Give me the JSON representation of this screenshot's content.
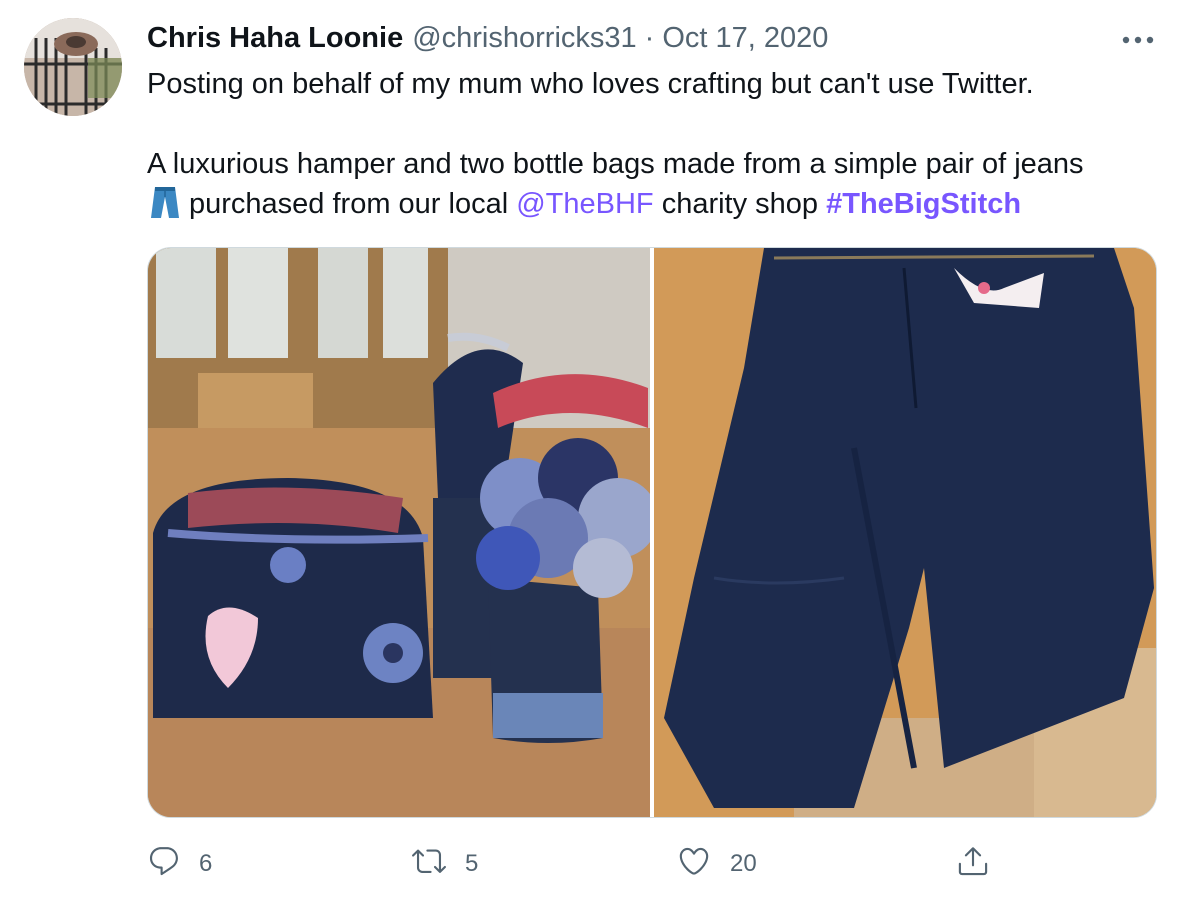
{
  "tweet": {
    "author_name": "Chris Haha Loonie",
    "author_handle": "@chrishorricks31",
    "separator": "·",
    "date": "Oct 17, 2020",
    "text_line1": "Posting on behalf of my mum who loves crafting but can't use Twitter.",
    "text_line2": "A luxurious hamper and two bottle bags made from a simple pair of jeans",
    "text_line3_part1": "purchased from our local",
    "mention": "@TheBHF",
    "text_line3_part2": "charity shop",
    "hashtag": "#TheBigStitch",
    "emoji_icon": "jeans-emoji"
  },
  "media": {
    "photos": [
      {
        "name": "photo-denim-hamper-and-bottle-bags"
      },
      {
        "name": "photo-pair-of-jeans"
      }
    ]
  },
  "actions": {
    "reply_count": "6",
    "retweet_count": "5",
    "like_count": "20",
    "icons": [
      "reply-icon",
      "retweet-icon",
      "like-icon",
      "share-icon",
      "more-icon"
    ]
  },
  "colors": {
    "text": "#0f1419",
    "secondary": "#536471",
    "accent": "#7856ff",
    "border": "#cfd9de"
  }
}
